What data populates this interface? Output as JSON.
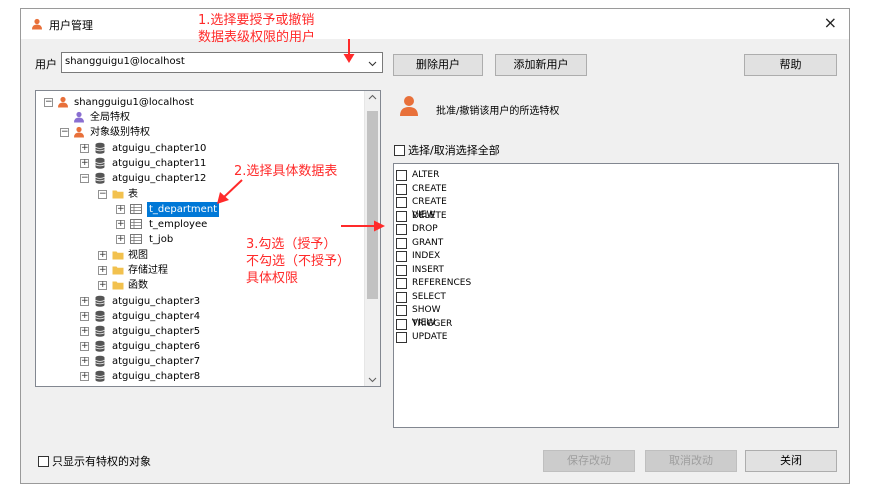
{
  "window": {
    "title": "用户管理",
    "close_glyph": "×"
  },
  "user": {
    "label": "用户",
    "value": "shangguigu1@localhost"
  },
  "buttons": {
    "delete_user": "删除用户",
    "add_user": "添加新用户",
    "help": "帮助",
    "save": "保存改动",
    "cancel": "取消改动",
    "close": "关闭"
  },
  "privilege_header": "批准/撤销该用户的所选特权",
  "select_all": "选择/取消选择全部",
  "show_only": "只显示有特权的对象",
  "tree": {
    "root": "shangguigu1@localhost",
    "global": "全局特权",
    "object_level": "对象级别特权",
    "db1": "atguigu_chapter10",
    "db2": "atguigu_chapter11",
    "db3": "atguigu_chapter12",
    "tables": "表",
    "t1": "t_department",
    "t2": "t_employee",
    "t3": "t_job",
    "views": "视图",
    "procs": "存储过程",
    "funcs": "函数",
    "db4": "atguigu_chapter3",
    "db5": "atguigu_chapter4",
    "db6": "atguigu_chapter5",
    "db7": "atguigu_chapter6",
    "db8": "atguigu_chapter7",
    "db9": "atguigu_chapter8"
  },
  "privileges": [
    "ALTER",
    "CREATE",
    "CREATE VIEW",
    "DELETE",
    "DROP",
    "GRANT",
    "INDEX",
    "INSERT",
    "REFERENCES",
    "SELECT",
    "SHOW VIEW",
    "TRIGGER",
    "UPDATE"
  ],
  "annotations": {
    "a1_line1": "1.选择要授予或撤销",
    "a1_line2": "数据表级权限的用户",
    "a2": "2.选择具体数据表",
    "a3_line1": "3.勾选（授予）",
    "a3_line2": "不勾选（不授予）",
    "a3_line3": "具体权限"
  },
  "colors": {
    "annotation": "#ff2a2a",
    "selection": "#0078d7",
    "user_icon": "#e8703a"
  }
}
